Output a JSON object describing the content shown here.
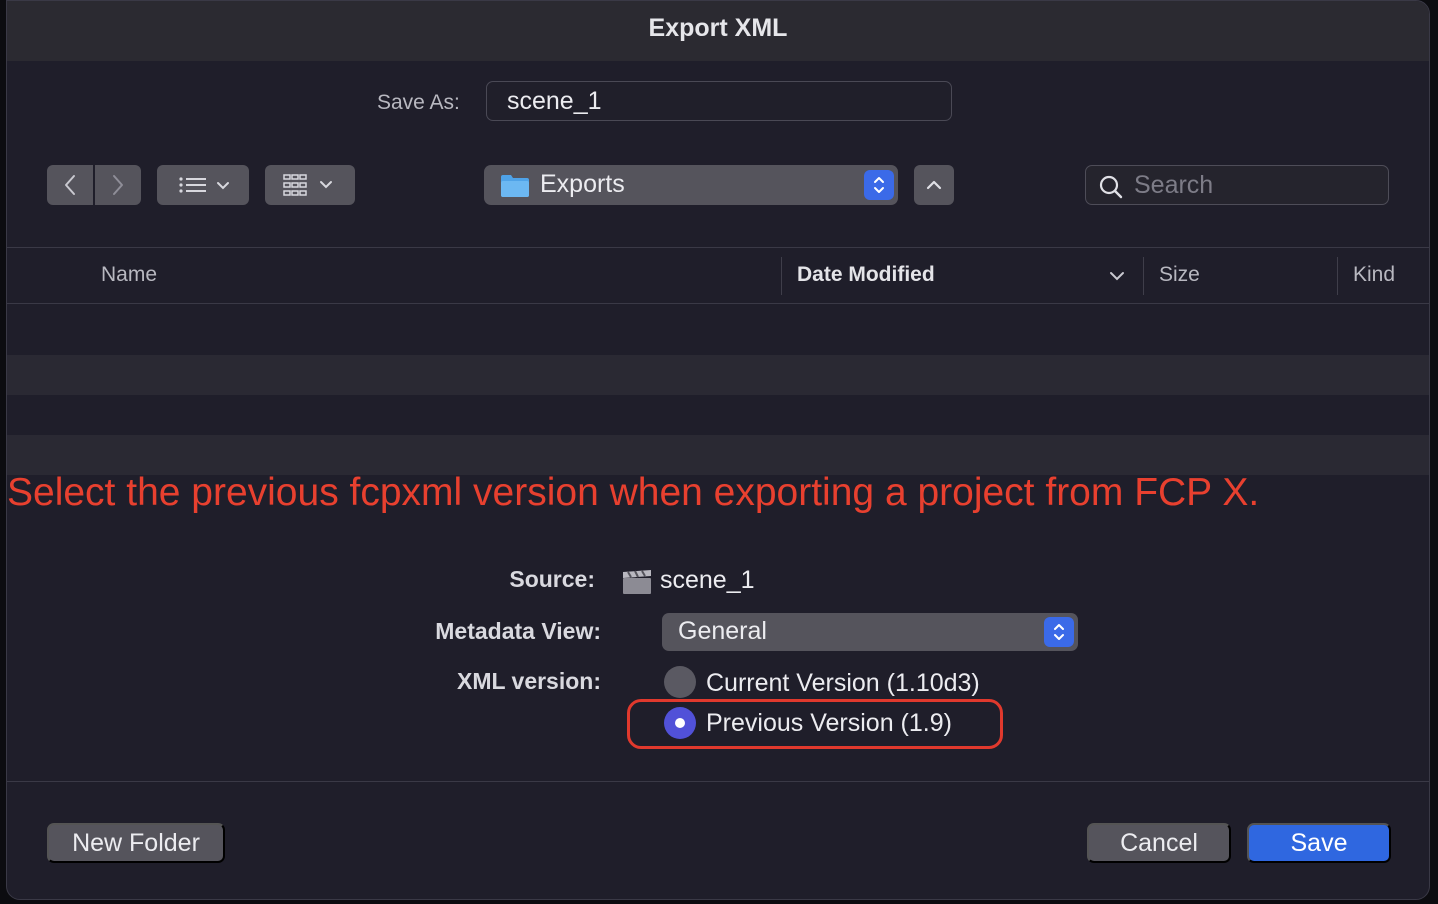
{
  "dialog": {
    "title": "Export XML"
  },
  "save_as": {
    "label": "Save As:",
    "value": "scene_1"
  },
  "toolbar": {
    "back_icon": "chevron-left-icon",
    "forward_icon": "chevron-right-icon",
    "list_view_icon": "list-view-icon",
    "grid_view_icon": "grid-view-icon",
    "location": "Exports",
    "search_placeholder": "Search"
  },
  "file_list": {
    "columns": [
      "Name",
      "Date Modified",
      "Size",
      "Kind"
    ],
    "sorted_by": "Date Modified"
  },
  "annotation": "Select the previous fcpxml version when exporting a project from FCP X.",
  "options": {
    "source_label": "Source:",
    "source_value": "scene_1",
    "metadata_label": "Metadata View:",
    "metadata_value": "General",
    "xml_version_label": "XML version:",
    "versions": [
      {
        "label": "Current Version (1.10d3)",
        "selected": false
      },
      {
        "label": "Previous Version (1.9)",
        "selected": true
      }
    ]
  },
  "footer": {
    "new_folder": "New Folder",
    "cancel": "Cancel",
    "save": "Save"
  },
  "colors": {
    "accent": "#2f67e0",
    "annotation": "#e8402f",
    "radio_selected": "#5151d8"
  }
}
